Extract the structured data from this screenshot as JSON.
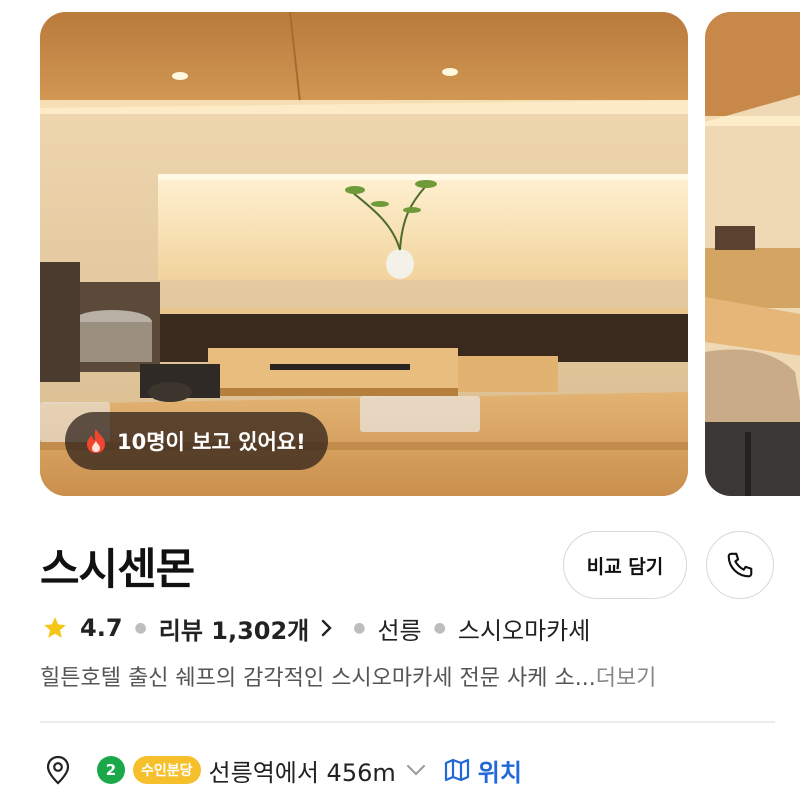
{
  "photos": {
    "viewers_text": "10명이 보고 있어요!"
  },
  "restaurant": {
    "name": "스시센몬",
    "compare_label": "비교 담기",
    "rating": "4.7",
    "reviews_text": "리뷰 1,302개",
    "area": "선릉",
    "category": "스시오마카세",
    "description": "힐튼호텔 출신 쉐프의 감각적인 스시오마카세 전문 사케 소...",
    "more_label": "더보기"
  },
  "location": {
    "line_number": "2",
    "line_badge_label": "수인분당",
    "distance_text": "선릉역에서 456m",
    "map_label": "위치"
  },
  "colors": {
    "star": "#f5c518",
    "line2_green": "#1aa84a",
    "suin_bundang_yellow": "#f6c02c",
    "link_blue": "#2268d8"
  }
}
